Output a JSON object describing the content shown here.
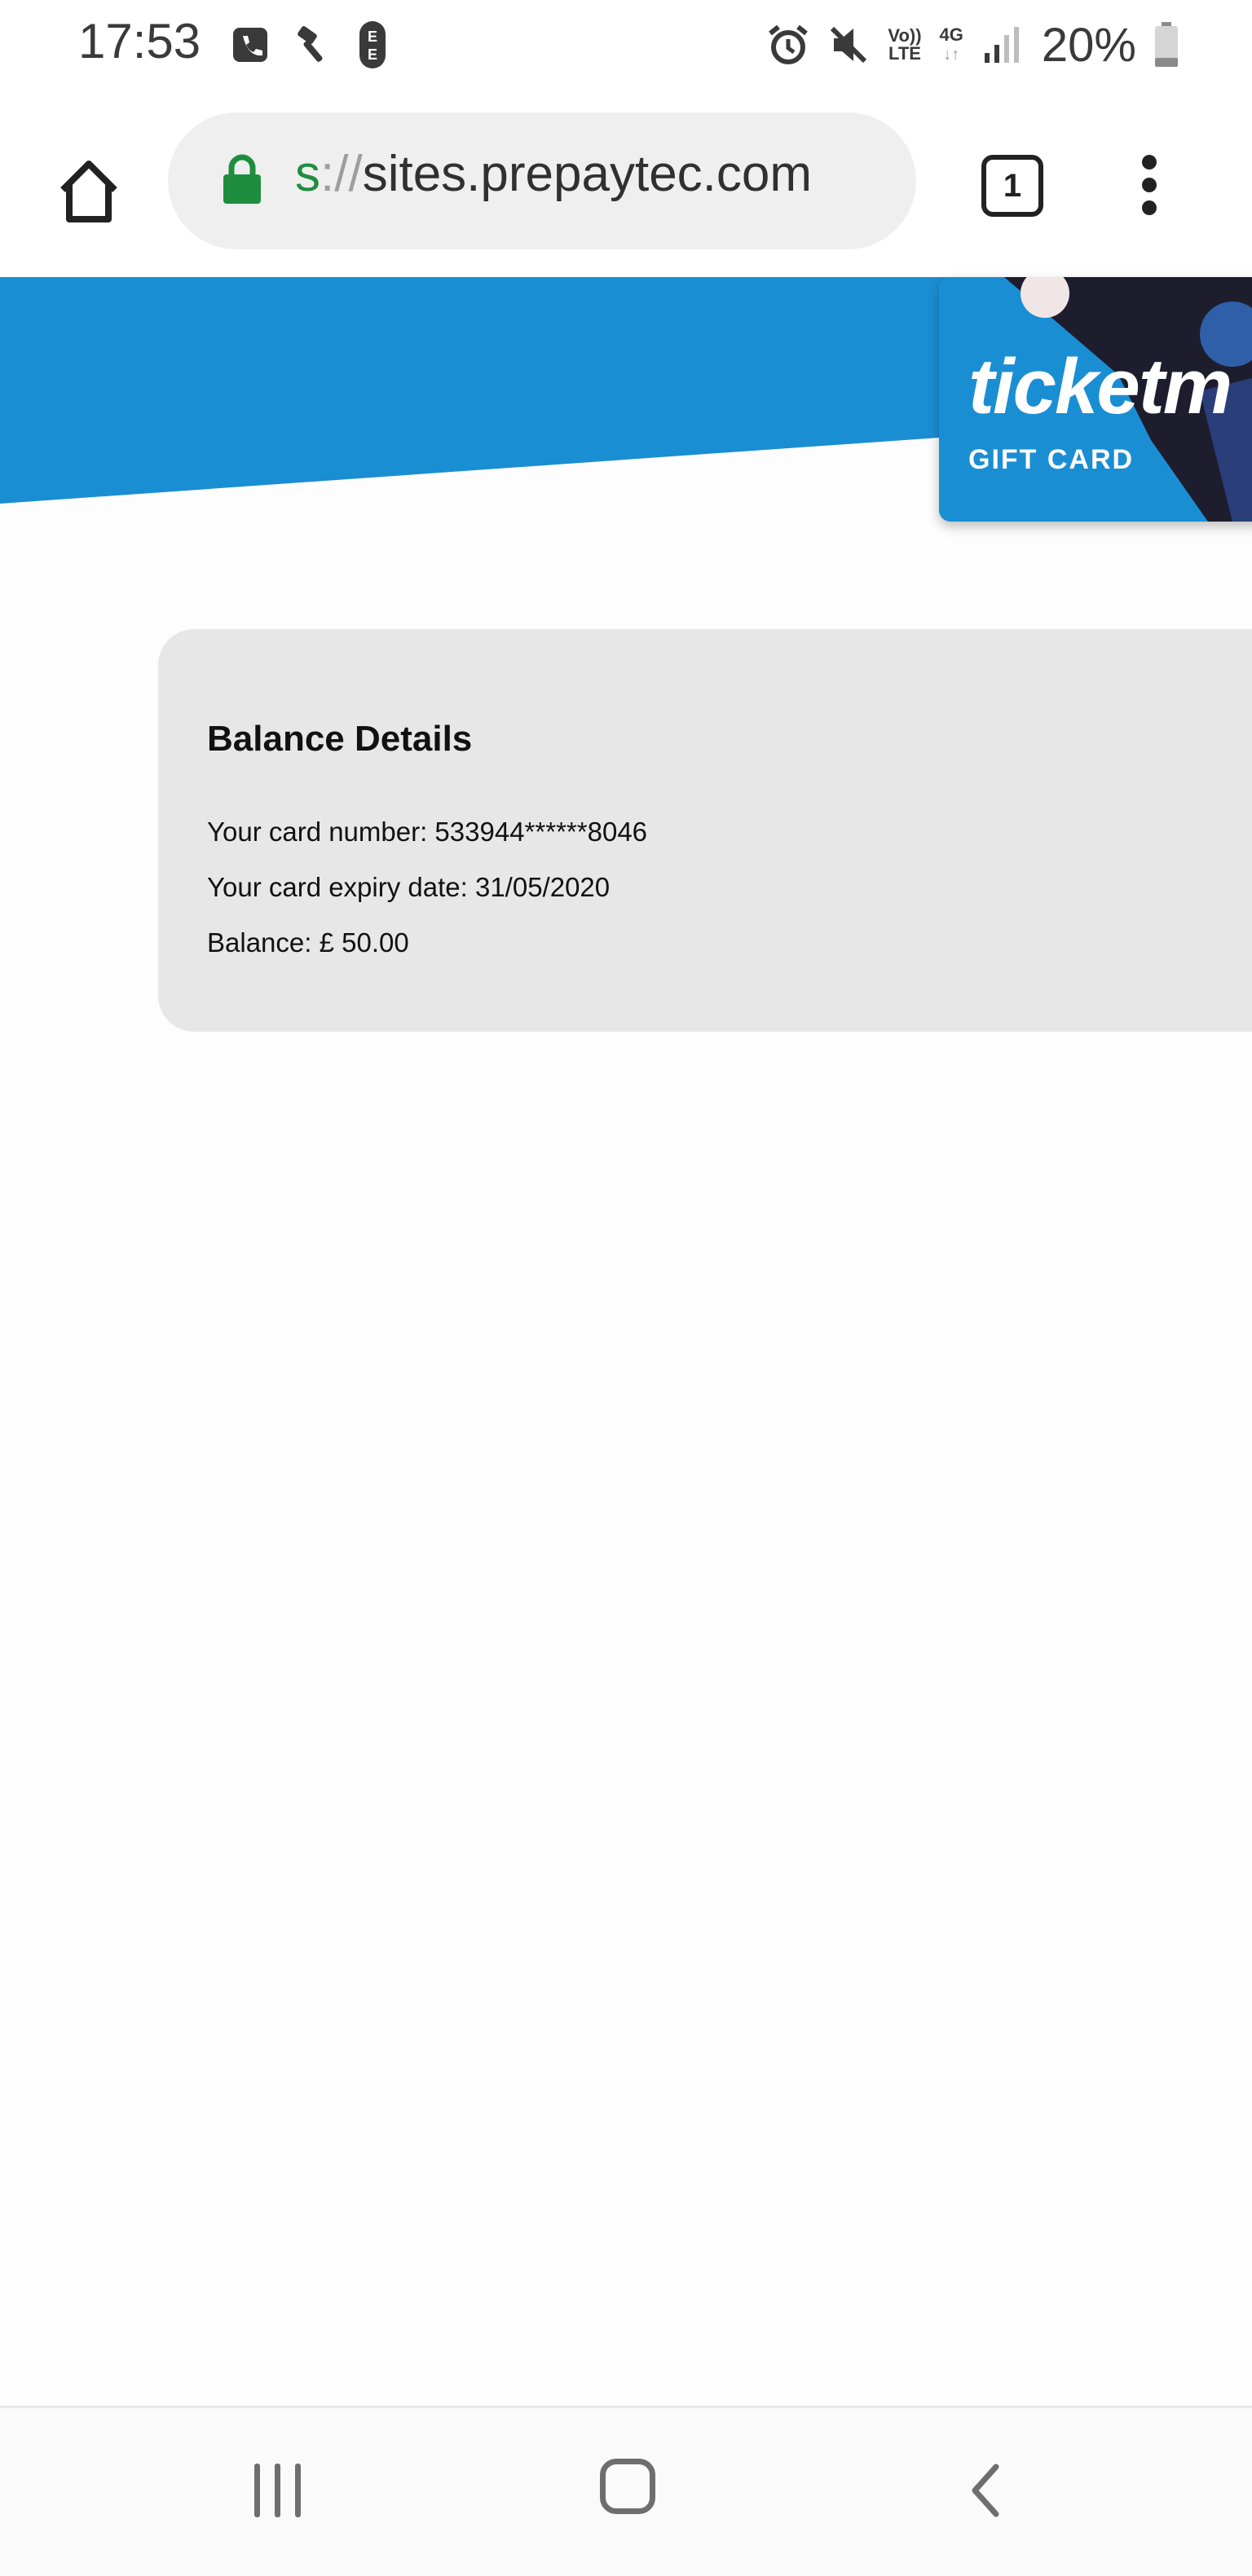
{
  "status_bar": {
    "time": "17:53",
    "battery_percent": "20%",
    "icons_left": [
      "phone-icon",
      "hammer-icon",
      "ee-carrier-icon"
    ],
    "icons_right": [
      "alarm-icon",
      "mute-icon",
      "volte-icon",
      "4g-data-icon",
      "signal-icon",
      "battery-icon"
    ],
    "volte_label_top": "Vo))",
    "volte_label_bottom": "LTE",
    "network_label": "4G"
  },
  "browser": {
    "url_scheme": "s",
    "url_separator": "://",
    "url_host": "sites.prepaytec.com",
    "tab_count": "1"
  },
  "banner": {
    "brand_color": "#1a8ed3",
    "gift_card_logo": "ticketm",
    "gift_card_label": "GIFT CARD"
  },
  "balance": {
    "title": "Balance Details",
    "card_number_line": "Your card number: 533944******8046",
    "expiry_line": "Your card expiry date: 31/05/2020",
    "balance_line": "Balance: £ 50.00"
  },
  "nav_bar": {
    "buttons": [
      "recents",
      "home",
      "back"
    ]
  }
}
